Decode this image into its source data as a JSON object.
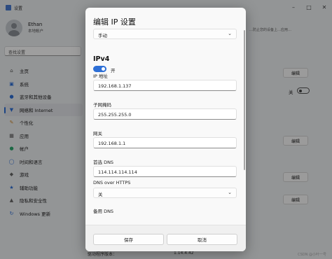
{
  "window": {
    "title": "设置"
  },
  "user": {
    "name": "Ethan",
    "account_type": "本地帐户"
  },
  "search": {
    "placeholder": "查找设置"
  },
  "nav": [
    {
      "label": "主页",
      "icon": "home-icon"
    },
    {
      "label": "系统",
      "icon": "system-icon"
    },
    {
      "label": "蓝牙和其他设备",
      "icon": "bluetooth-icon"
    },
    {
      "label": "网络和 Internet",
      "icon": "network-icon",
      "active": true
    },
    {
      "label": "个性化",
      "icon": "brush-icon"
    },
    {
      "label": "应用",
      "icon": "apps-icon"
    },
    {
      "label": "帐户",
      "icon": "account-icon"
    },
    {
      "label": "时间和语言",
      "icon": "globe-icon"
    },
    {
      "label": "游戏",
      "icon": "gamepad-icon"
    },
    {
      "label": "辅助功能",
      "icon": "accessibility-icon"
    },
    {
      "label": "隐私和安全性",
      "icon": "shield-icon"
    },
    {
      "label": "Windows 更新",
      "icon": "update-icon"
    }
  ],
  "right_panel": {
    "link_text": "…防止您的设备上…应用…",
    "edit_label": "编辑",
    "off_label": "关",
    "driver_row_label": "驱动程序版本：",
    "driver_row_value": "1.14.4.42"
  },
  "watermark": "CSDN @小叶一号",
  "dialog": {
    "title": "编辑 IP 设置",
    "mode_value": "手动",
    "section": "IPv4",
    "toggle_label": "开",
    "ip_label": "IP 地址",
    "ip_value": "192.168.1.137",
    "mask_label": "子网掩码",
    "mask_value": "255.255.255.0",
    "gateway_label": "网关",
    "gateway_value": "192.168.1.1",
    "dns_label": "首选 DNS",
    "dns_value": "114.114.114.114",
    "doh_label": "DNS over HTTPS",
    "doh_value": "关",
    "alt_dns_label": "备用 DNS",
    "save_label": "保存",
    "cancel_label": "取消"
  },
  "colors": {
    "accent": "#2d6fd6",
    "overlay": "rgba(0,0,0,0.38)"
  }
}
